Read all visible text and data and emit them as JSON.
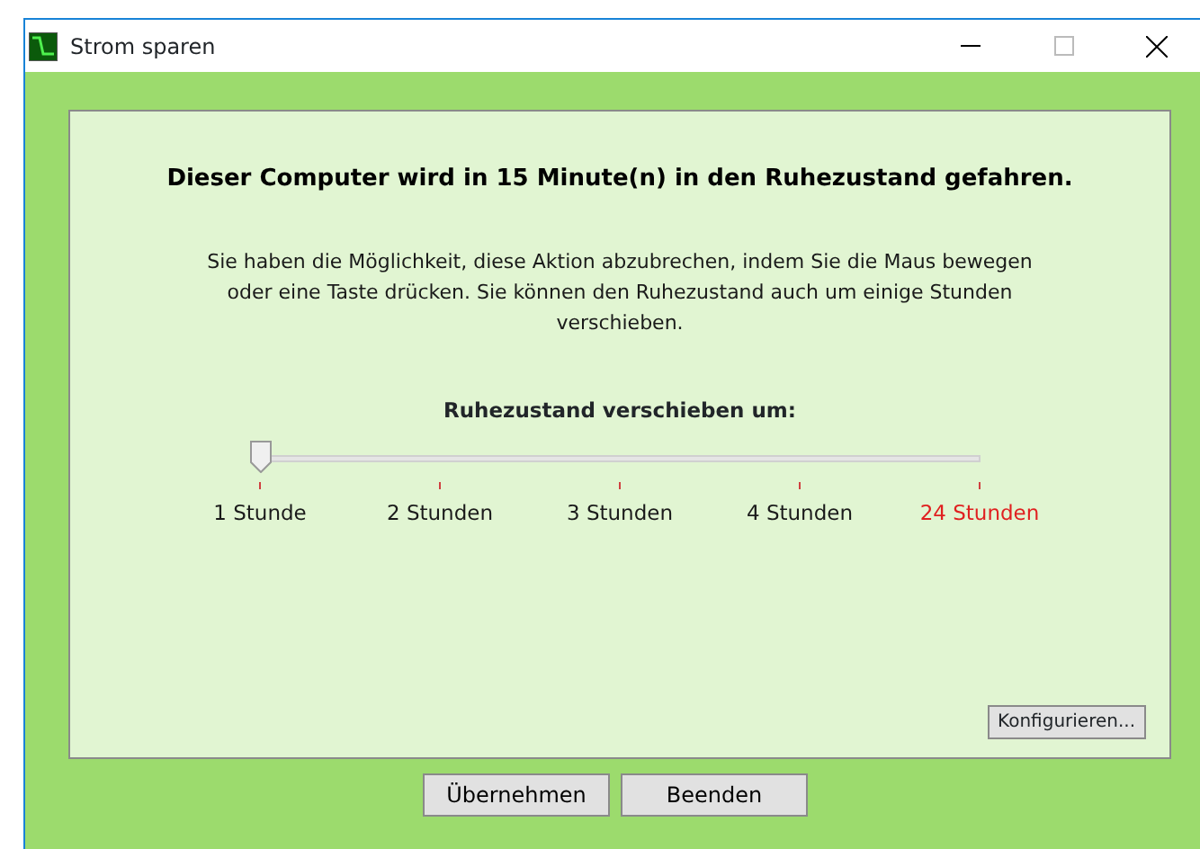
{
  "window": {
    "title": "Strom sparen"
  },
  "heading": "Dieser Computer wird in 15 Minute(n) in den Ruhezustand gefahren.",
  "description": "Sie haben die Möglichkeit, diese Aktion abzubrechen, indem Sie die Maus bewegen oder eine Taste drücken. Sie können den Ruhezustand auch um einige Stunden verschieben.",
  "slider": {
    "label": "Ruhezustand verschieben um:",
    "level": 0,
    "ticks": [
      {
        "label": "1 Stunde",
        "color": "#1a1a1a"
      },
      {
        "label": "2 Stunden",
        "color": "#1a1a1a"
      },
      {
        "label": "3 Stunden",
        "color": "#1a1a1a"
      },
      {
        "label": "4 Stunden",
        "color": "#1a1a1a"
      },
      {
        "label": "24 Stunden",
        "color": "#e02020"
      }
    ]
  },
  "configure_button": "Konfigurieren...",
  "buttons": [
    "Übernehmen",
    "Beenden"
  ]
}
